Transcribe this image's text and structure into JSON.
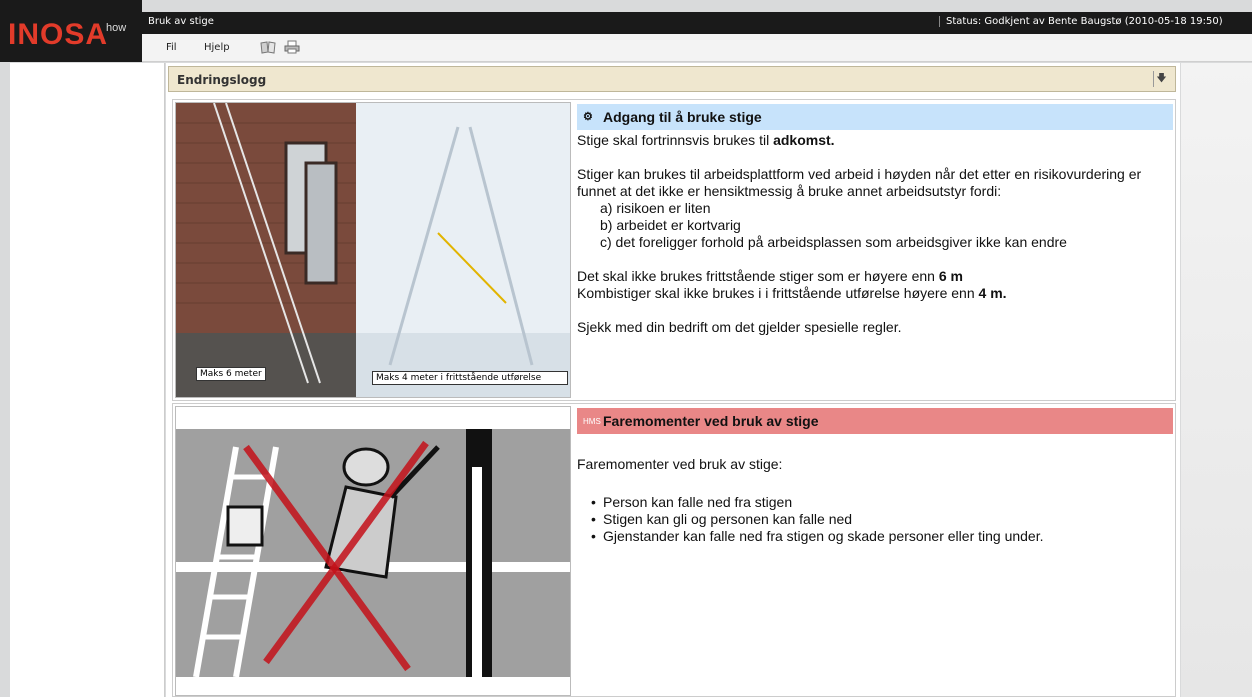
{
  "app": {
    "brand": "INOSA",
    "brand_suffix": "how",
    "window_title": "Bruk av stige",
    "status": "Status: Godkjent av Bente Baugstø (2010-05-18 19:50)"
  },
  "menu": {
    "items": [
      "Fil",
      "Hjelp"
    ],
    "toolbar_icons": [
      "book-icon",
      "print-icon"
    ]
  },
  "changelog": {
    "label": "Endringslogg"
  },
  "section1": {
    "caption_left": "Maks 6 meter",
    "caption_right": "Maks 4 meter i frittstående utførelse",
    "header": "Adgang til å bruke stige",
    "intro_prefix": "Stige skal fortrinnsvis brukes til ",
    "intro_bold": "adkomst.",
    "paragraph": "Stiger kan brukes til arbeidsplattform ved arbeid i høyden når det etter en risikovurdering er funnet at det ikke er hensiktmessig å bruke annet arbeidsutstyr fordi:",
    "items": [
      "a) risikoen er liten",
      "b) arbeidet er kortvarig",
      "c) det foreligger forhold på arbeidsplassen som arbeidsgiver ikke kan endre"
    ],
    "rule1_prefix": "Det skal ikke brukes frittstående stiger som er høyere enn ",
    "rule1_bold": "6 m",
    "rule2_prefix": "Kombistiger skal ikke brukes i i frittstående utførelse høyere enn ",
    "rule2_bold": "4 m.",
    "note": "Sjekk med din bedrift om det gjelder spesielle regler."
  },
  "section2": {
    "header_icon": "HMS",
    "header": "Faremomenter ved bruk av stige",
    "intro": "Faremomenter ved bruk av stige:",
    "bullets": [
      "Person kan falle ned fra stigen",
      "Stigen kan gli og personen kan falle ned",
      "Gjenstander kan falle ned fra stigen og skade personer eller ting under."
    ]
  },
  "colors": {
    "logo_red": "#e23b2a",
    "header_blue": "#c7e3fb",
    "header_red": "#e98787",
    "changelog_bg": "#efe7cf"
  }
}
